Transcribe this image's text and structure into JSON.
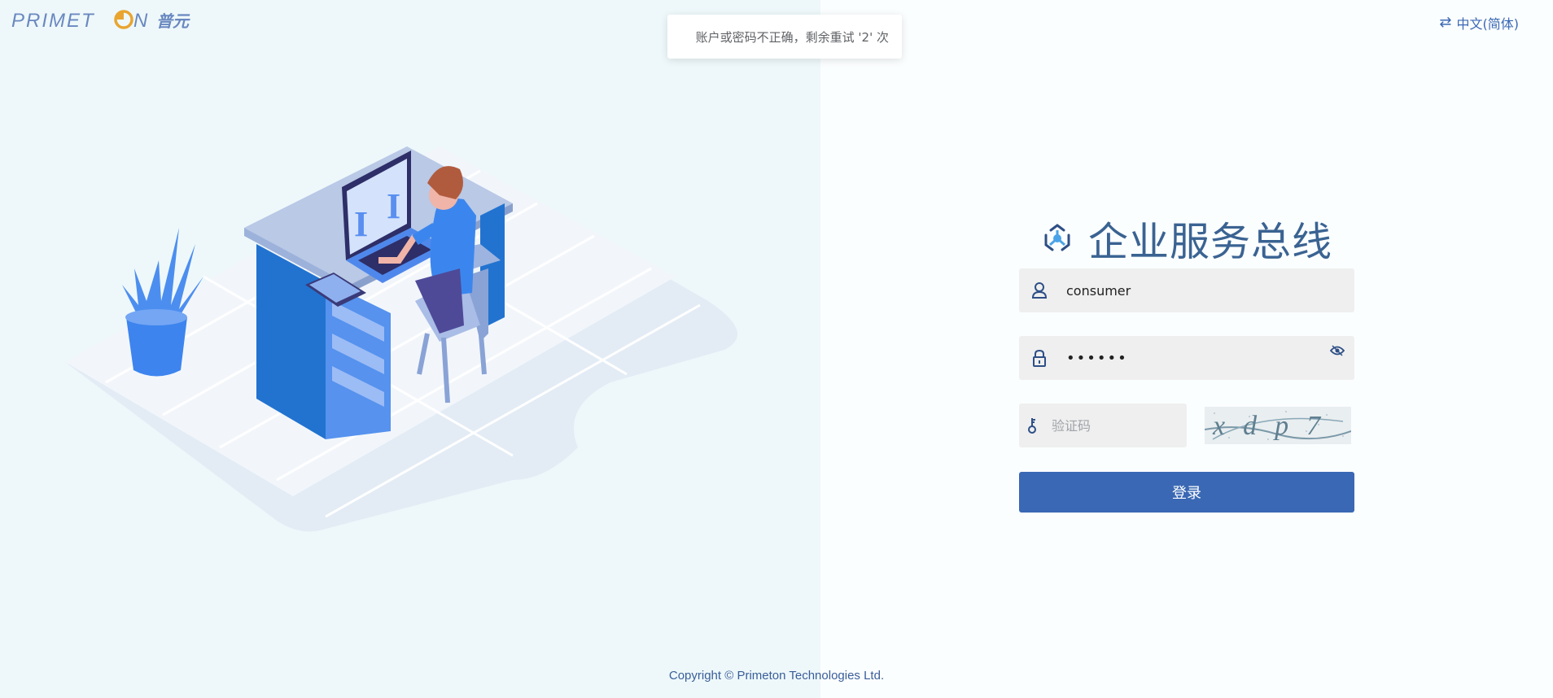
{
  "header": {
    "logo_text": "PRIMETON",
    "logo_cn": "普元"
  },
  "toast": {
    "message": "账户或密码不正确，剩余重试 '2' 次"
  },
  "lang_switch": {
    "label": "中文(简体)",
    "icon": "swap-arrows-icon"
  },
  "login": {
    "title": "企业服务总线",
    "username": {
      "value": "consumer",
      "icon": "user-icon"
    },
    "password": {
      "value": "••••••",
      "icon": "lock-icon",
      "toggle_icon": "eye-icon"
    },
    "captcha": {
      "placeholder": "验证码",
      "icon": "key-icon",
      "image_text": "xdp7"
    },
    "submit_label": "登录"
  },
  "footer": {
    "copyright": "Copyright © Primeton Technologies Ltd."
  },
  "colors": {
    "accent": "#3a68b4",
    "title": "#3a6392",
    "left_bg": "#eef8fa",
    "field_bg": "#efefef"
  }
}
